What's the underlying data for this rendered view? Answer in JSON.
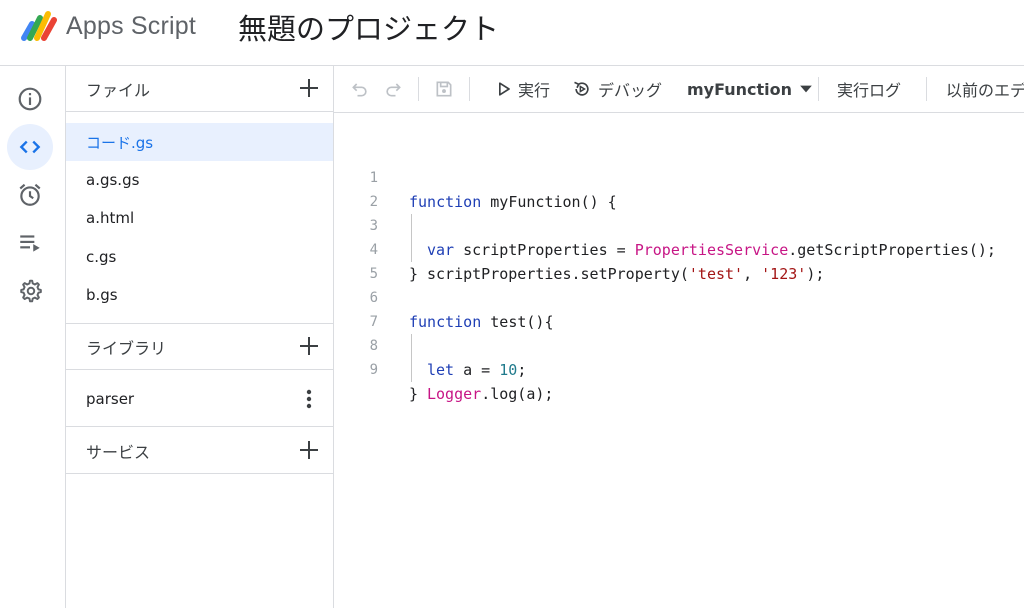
{
  "header": {
    "app_name": "Apps Script",
    "project_title": "無題のプロジェクト"
  },
  "rail": {
    "items": [
      "overview",
      "editor",
      "triggers",
      "executions",
      "settings"
    ],
    "active": "editor"
  },
  "files": {
    "header": "ファイル",
    "items": [
      "コード.gs",
      "a.gs.gs",
      "a.html",
      "c.gs",
      "b.gs"
    ],
    "selected": "コード.gs"
  },
  "libraries": {
    "header": "ライブラリ",
    "items": [
      "parser"
    ]
  },
  "services": {
    "header": "サービス"
  },
  "toolbar": {
    "run": "実行",
    "debug": "デバッグ",
    "function_name": "myFunction",
    "exec_log": "実行ログ",
    "previous": "以前のエデ"
  },
  "code": {
    "line_numbers": [
      "1",
      "2",
      "3",
      "4",
      "5",
      "6",
      "7",
      "8",
      "9"
    ],
    "l1": {
      "kw": "function",
      "rest": " myFunction() {"
    },
    "l2": {
      "kw": "var",
      "mid": " scriptProperties = ",
      "svc": "PropertiesService",
      "rest": ".getScriptProperties();"
    },
    "l3": {
      "a": "scriptProperties.setProperty(",
      "s1": "'test'",
      "b": ", ",
      "s2": "'123'",
      "c": ");"
    },
    "l4": "}",
    "l6": {
      "kw": "function",
      "rest": " test(){"
    },
    "l7": {
      "kw": "let",
      "mid": " a = ",
      "num": "10",
      "rest": ";"
    },
    "l8": {
      "svc": "Logger",
      "rest": ".log(a);"
    },
    "l9": "}"
  },
  "colors": {
    "accent": "#1a73e8",
    "selected_bg": "#e8f0fe",
    "keyword": "#1f3fb5",
    "service": "#c71585",
    "string": "#a31515"
  }
}
